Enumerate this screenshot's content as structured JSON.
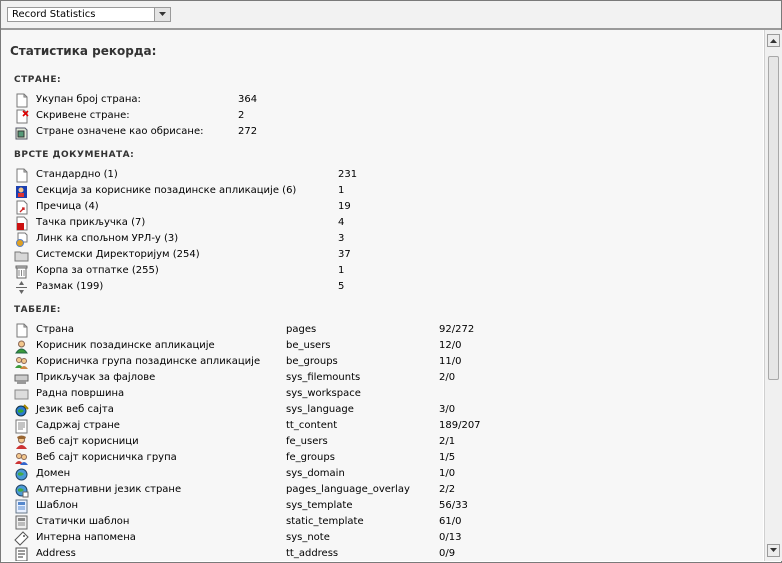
{
  "toolbar": {
    "function_select": "Record Statistics"
  },
  "page_title": "Статистика рекорда:",
  "sections": {
    "pages": {
      "heading": "СТРАНЕ:",
      "rows": [
        {
          "label": "Укупан број страна:",
          "value": "364",
          "icon": "page-icon"
        },
        {
          "label": "Скривене стране:",
          "value": "2",
          "icon": "hidden-page-icon"
        },
        {
          "label": "Стране означене као обрисане:",
          "value": "272",
          "icon": "deleted-page-icon"
        }
      ]
    },
    "doktypes": {
      "heading": "ВРСТЕ ДОКУМЕНАТА:",
      "rows": [
        {
          "label": "Стандардно (1)",
          "value": "231",
          "icon": "page-icon"
        },
        {
          "label": "Секција за кориснике позадинске апликације (6)",
          "value": "1",
          "icon": "be-user-section-icon"
        },
        {
          "label": "Пречица (4)",
          "value": "19",
          "icon": "shortcut-icon"
        },
        {
          "label": "Тачка прикључка (7)",
          "value": "4",
          "icon": "mountpoint-icon"
        },
        {
          "label": "Линк ка спољном УРЛ-у (3)",
          "value": "3",
          "icon": "external-url-icon"
        },
        {
          "label": "Системски Директоријум (254)",
          "value": "37",
          "icon": "folder-icon"
        },
        {
          "label": "Корпа за отпатке (255)",
          "value": "1",
          "icon": "recycler-icon"
        },
        {
          "label": "Размак (199)",
          "value": "5",
          "icon": "spacer-icon"
        }
      ]
    },
    "tables": {
      "heading": "ТАБЕЛЕ:",
      "rows": [
        {
          "label": "Страна",
          "table": "pages",
          "count": "92/272",
          "icon": "page-icon"
        },
        {
          "label": "Корисник позадинске апликације",
          "table": "be_users",
          "count": "12/0",
          "icon": "user-icon"
        },
        {
          "label": "Корисничка група позадинске апликације",
          "table": "be_groups",
          "count": "11/0",
          "icon": "group-icon"
        },
        {
          "label": "Прикључак за фајлове",
          "table": "sys_filemounts",
          "count": "2/0",
          "icon": "filemount-icon"
        },
        {
          "label": "Радна површина",
          "table": "sys_workspace",
          "count": "",
          "icon": "workspace-icon"
        },
        {
          "label": "Језик веб сајта",
          "table": "sys_language",
          "count": "3/0",
          "icon": "language-icon"
        },
        {
          "label": "Садржај стране",
          "table": "tt_content",
          "count": "189/207",
          "icon": "content-icon"
        },
        {
          "label": "Веб сајт корисници",
          "table": "fe_users",
          "count": "2/1",
          "icon": "fe-user-icon"
        },
        {
          "label": "Веб сајт корисничка група",
          "table": "fe_groups",
          "count": "1/5",
          "icon": "fe-group-icon"
        },
        {
          "label": "Домен",
          "table": "sys_domain",
          "count": "1/0",
          "icon": "domain-icon"
        },
        {
          "label": "Алтернативни језик стране",
          "table": "pages_language_overlay",
          "count": "2/2",
          "icon": "language-overlay-icon"
        },
        {
          "label": "Шаблон",
          "table": "sys_template",
          "count": "56/33",
          "icon": "template-icon"
        },
        {
          "label": "Статички шаблон",
          "table": "static_template",
          "count": "61/0",
          "icon": "static-template-icon"
        },
        {
          "label": "Интерна напомена",
          "table": "sys_note",
          "count": "0/13",
          "icon": "note-icon"
        },
        {
          "label": "Address",
          "table": "tt_address",
          "count": "0/9",
          "icon": "address-icon"
        }
      ]
    }
  },
  "colors": {
    "background": "#f7f7f7",
    "border": "#9a9a9a",
    "text": "#000000",
    "heading": "#333333"
  }
}
